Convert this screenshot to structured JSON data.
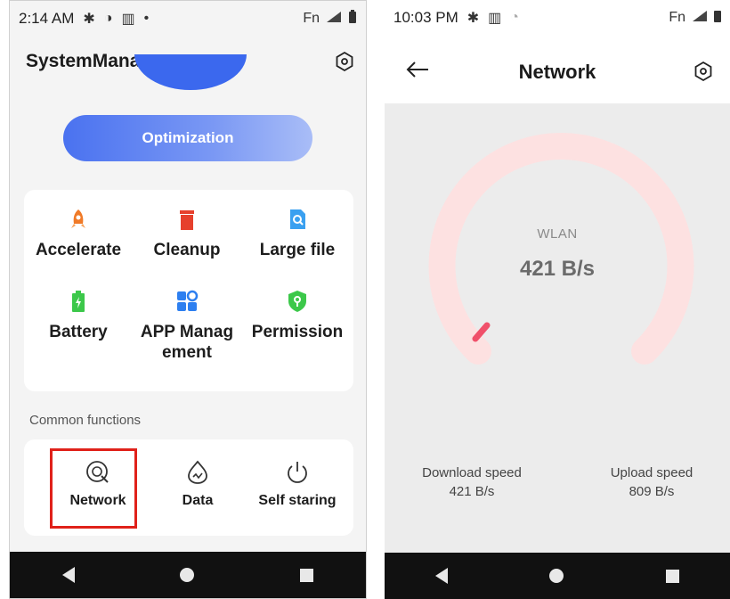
{
  "left": {
    "status": {
      "time": "2:14 AM",
      "fn": "Fn",
      "sim_badge": "x4"
    },
    "title": "SystemManager",
    "optimize_label": "Optimization",
    "tiles": [
      {
        "label": "Accelerate",
        "icon": "rocket-icon",
        "color": "#f07a28"
      },
      {
        "label": "Cleanup",
        "icon": "trash-icon",
        "color": "#e6402c"
      },
      {
        "label": "Large file",
        "icon": "file-search-icon",
        "color": "#3aa0f0"
      },
      {
        "label": "Battery",
        "icon": "battery-icon",
        "color": "#3cc84a"
      },
      {
        "label": "APP Manag\nement",
        "icon": "apps-icon",
        "color": "#2d7ff0"
      },
      {
        "label": "Permission",
        "icon": "shield-icon",
        "color": "#3cc84a"
      }
    ],
    "common_label": "Common functions",
    "functions": [
      {
        "label": "Network",
        "icon": "network-icon"
      },
      {
        "label": "Data",
        "icon": "data-icon"
      },
      {
        "label": "Self staring",
        "icon": "power-icon"
      }
    ]
  },
  "right": {
    "status": {
      "time": "10:03 PM",
      "fn": "Fn",
      "sim_badge": "x4"
    },
    "title": "Network",
    "gauge_label": "WLAN",
    "gauge_value": "421 B/s",
    "download_label": "Download speed",
    "download_value": "421 B/s",
    "upload_label": "Upload speed",
    "upload_value": "809 B/s"
  },
  "colors": {
    "accent": "#3b68ee",
    "highlight": "#e0211a",
    "gauge_track": "#fde1e1",
    "gauge_needle": "#f0506a"
  }
}
